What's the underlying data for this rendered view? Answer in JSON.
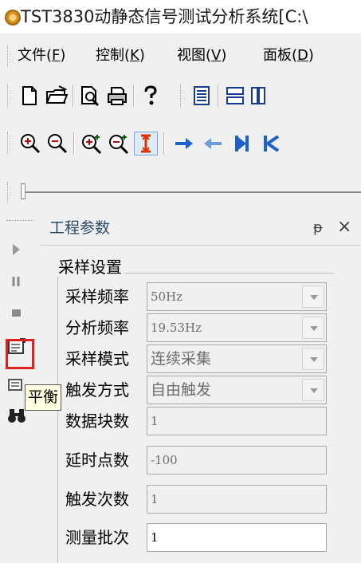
{
  "window": {
    "title": "TST3830动静态信号测试分析系统[C:\\"
  },
  "menu": [
    {
      "label": "文件(",
      "key": "F",
      "suffix": ")"
    },
    {
      "label": "控制(",
      "key": "K",
      "suffix": ")"
    },
    {
      "label": "视图(",
      "key": "V",
      "suffix": ")"
    },
    {
      "label": "面板(",
      "key": "D",
      "suffix": ")"
    }
  ],
  "toolbar1": [
    "new-file-icon",
    "open-folder-icon",
    "print-preview-icon",
    "print-icon",
    "help-icon",
    "layout-list-icon",
    "layout-rows-icon",
    "layout-columns-icon"
  ],
  "toolbar2": [
    "zoom-in-icon",
    "zoom-out-icon",
    "zoom-in-x-icon",
    "zoom-out-x-icon",
    "cursor-icon",
    "arrow-right-icon",
    "arrow-left-icon",
    "jump-end-icon",
    "jump-start-icon"
  ],
  "left_toolbar": [
    "play-icon",
    "pause-icon",
    "stop-icon",
    "balance-icon",
    "list-icon",
    "binoculars-icon"
  ],
  "tooltip": "平衡",
  "panel": {
    "title": "工程参数",
    "pin_symbol": "ᵽ",
    "close_symbol": "×",
    "group_title": "采样设置",
    "fields": [
      {
        "label": "采样频率",
        "value": "50Hz",
        "type": "dropdown"
      },
      {
        "label": "分析频率",
        "value": "19.53Hz",
        "type": "dropdown"
      },
      {
        "label": "采样模式",
        "value": "连续采集",
        "type": "dropdown"
      },
      {
        "label": "触发方式",
        "value": "自由触发",
        "type": "dropdown"
      },
      {
        "label": "数据块数",
        "value": "1",
        "type": "readonly"
      },
      {
        "label": "延时点数",
        "value": "-100",
        "type": "readonly"
      },
      {
        "label": "触发次数",
        "value": "1",
        "type": "readonly"
      },
      {
        "label": "测量批次",
        "value": "1",
        "type": "editable"
      }
    ]
  },
  "colors": {
    "highlight": "#e02020",
    "tooltip_bg": "#ffffe1",
    "panel_title": "#2a4a6a"
  }
}
